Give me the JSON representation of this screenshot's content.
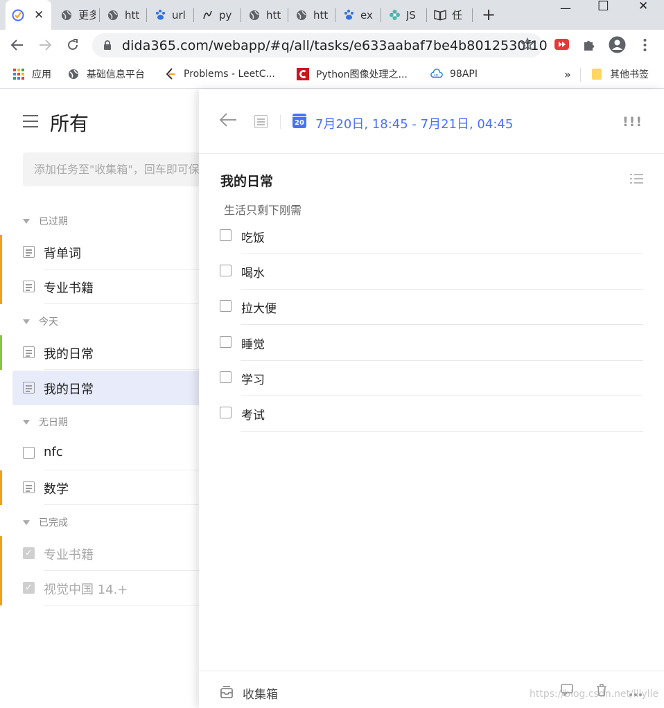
{
  "browser": {
    "tabs": [
      {
        "label": "",
        "icon": "dida-check-icon",
        "active": true
      },
      {
        "label": "更多",
        "icon": "globe-icon"
      },
      {
        "label": "htt",
        "icon": "globe-icon"
      },
      {
        "label": "url",
        "icon": "baidu-paw-icon"
      },
      {
        "label": "py",
        "icon": "script-icon"
      },
      {
        "label": "htt",
        "icon": "globe-icon"
      },
      {
        "label": "htt",
        "icon": "globe-icon"
      },
      {
        "label": "ex",
        "icon": "baidu-paw-icon"
      },
      {
        "label": "JS",
        "icon": "flower-icon"
      },
      {
        "label": "任",
        "icon": "book-icon"
      }
    ],
    "close_glyph": "✕",
    "new_tab_glyph": "+",
    "window_controls": {
      "minimize": "—",
      "maximize": "☐",
      "close": "✕"
    },
    "url": "dida365.com/webapp/#q/all/tasks/e633aabaf7be4b8012530f10",
    "bookmarks": [
      {
        "label": "应用",
        "icon": "apps-grid-icon"
      },
      {
        "label": "基础信息平台",
        "icon": "globe-icon"
      },
      {
        "label": "Problems - LeetC...",
        "icon": "leetcode-icon"
      },
      {
        "label": "Python图像处理之...",
        "icon": "csdn-icon"
      },
      {
        "label": "98API",
        "icon": "cloud-api-icon"
      }
    ],
    "bookmarks_overflow": "»",
    "other_bookmarks": "其他书签"
  },
  "sidebar": {
    "title": "所有",
    "add_placeholder": "添加任务至\"收集箱\"，回车即可保存",
    "sections": [
      {
        "label": "已过期",
        "tasks": [
          {
            "name": "背单词",
            "kind": "note",
            "bar": "#f0a020"
          },
          {
            "name": "专业书籍",
            "kind": "note",
            "bar": "#f0a020"
          }
        ]
      },
      {
        "label": "今天",
        "tasks": [
          {
            "name": "我的日常",
            "kind": "note",
            "bar": "#8bc34a"
          },
          {
            "name": "我的日常",
            "kind": "note",
            "bar": "",
            "selected": true
          }
        ]
      },
      {
        "label": "无日期",
        "tasks": [
          {
            "name": "nfc",
            "kind": "checkbox",
            "bar": ""
          },
          {
            "name": "数学",
            "kind": "note",
            "bar": "#f0a020"
          }
        ]
      },
      {
        "label": "已完成",
        "tasks": [
          {
            "name": "专业书籍",
            "kind": "done",
            "bar": "#f0a020"
          },
          {
            "name": "视觉中国 14.+",
            "kind": "done",
            "bar": "#f0a020"
          }
        ]
      }
    ]
  },
  "detail": {
    "date": "7月20日, 18:45 - 7月21日, 04:45",
    "calendar_day": "20",
    "priority": "!!!",
    "title": "我的日常",
    "description": "生活只剩下刚需",
    "subtasks": [
      "吃饭",
      "喝水",
      "拉大便",
      "睡觉",
      "学习",
      "考试"
    ],
    "footer_list": "收集箱",
    "watermark": "https://blog.csdn.net/lllylle",
    "accent_color": "#4772fa"
  }
}
